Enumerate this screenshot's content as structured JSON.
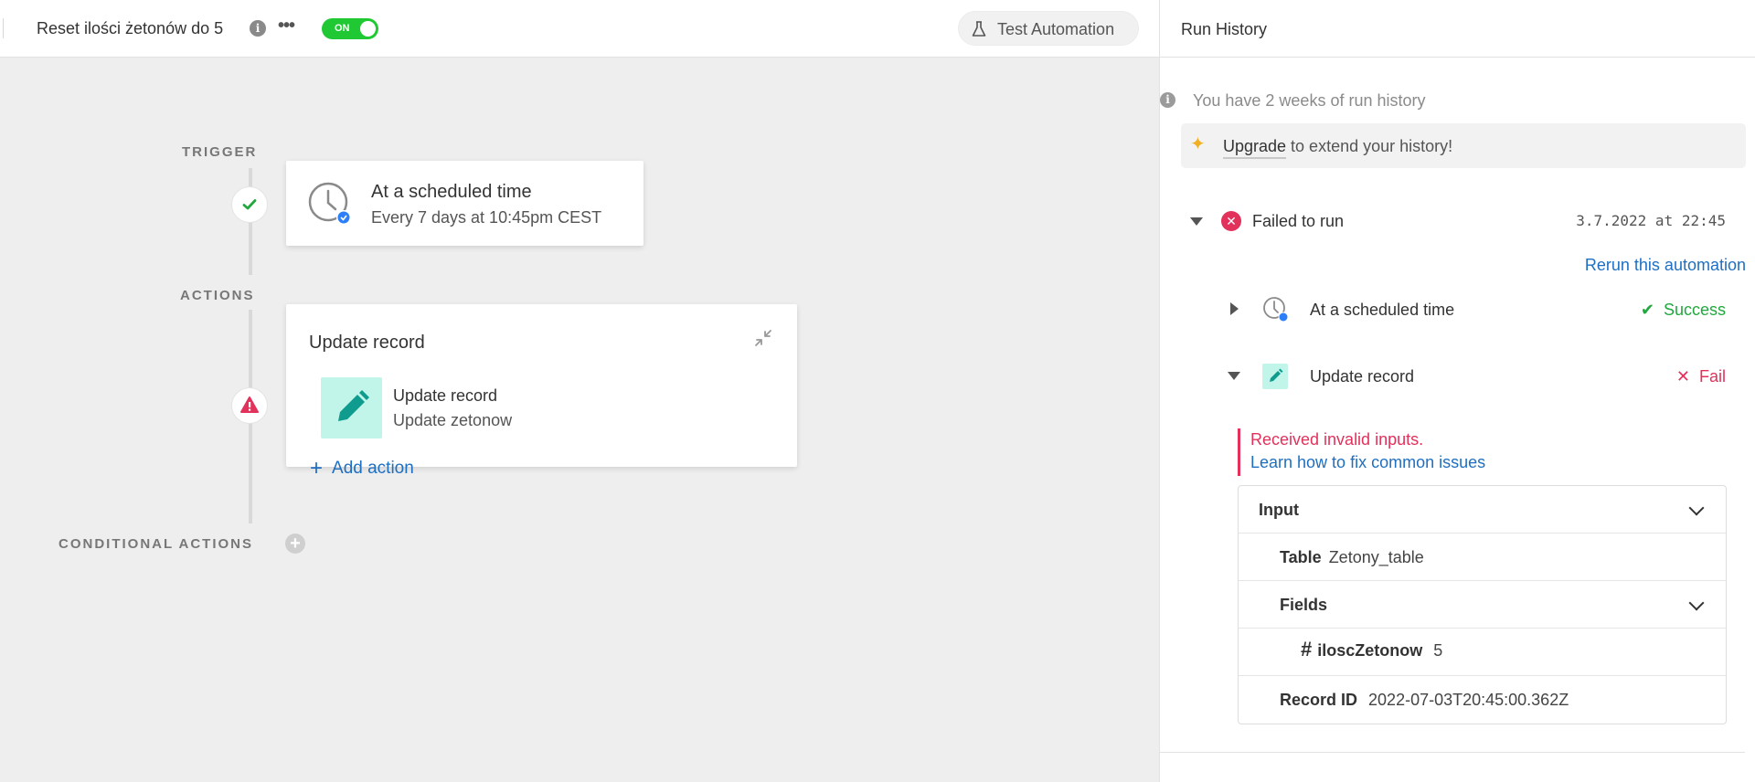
{
  "header": {
    "title": "Reset ilości żetonów do 5",
    "toggle_label": "ON",
    "test_button": "Test Automation"
  },
  "canvas": {
    "trigger_label": "TRIGGER",
    "actions_label": "ACTIONS",
    "conditional_label": "CONDITIONAL ACTIONS",
    "trigger": {
      "title": "At a scheduled time",
      "subtitle": "Every 7 days at 10:45pm CEST"
    },
    "action": {
      "card_title": "Update record",
      "step_name": "Update record",
      "step_sub": "Update zetonow",
      "add_action": "Add action"
    }
  },
  "panel": {
    "title": "Run History",
    "history_note": "You have 2 weeks of run history",
    "upgrade_link": "Upgrade",
    "upgrade_rest": " to extend your history!",
    "run": {
      "status": "Failed to run",
      "time": "3.7.2022 at 22:45",
      "rerun": "Rerun this automation"
    },
    "steps": [
      {
        "label": "At a scheduled time",
        "status": "Success"
      },
      {
        "label": "Update record",
        "status": "Fail"
      }
    ],
    "error": {
      "message": "Received invalid inputs.",
      "link": "Learn how to fix common issues"
    },
    "input": {
      "header": "Input",
      "table_label": "Table",
      "table_value": "Zetony_table",
      "fields_label": "Fields",
      "field_name": "iloscZetonow",
      "field_value": "5",
      "record_label": "Record ID",
      "record_value": "2022-07-03T20:45:00.362Z"
    }
  },
  "colors": {
    "toggle_on": "#20c933",
    "link": "#1f6fc1",
    "error": "#e2315b",
    "success": "#20a83e",
    "tile": "#c2f5e9",
    "pencil": "#0f9b8e"
  }
}
